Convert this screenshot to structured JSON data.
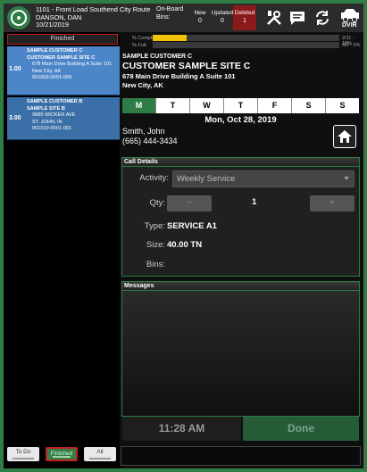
{
  "header": {
    "route_line": "1101 - Front Load Southend City Route",
    "driver": "DANSON, DAN",
    "date": "10/21/2019",
    "onboard_label_1": "On-Board",
    "onboard_label_2": "Bins:",
    "counters": [
      {
        "label": "New",
        "value": "0"
      },
      {
        "label": "Updated",
        "value": "0"
      },
      {
        "label": "Deleted",
        "value": "1"
      }
    ],
    "dvir_label": "DVIR"
  },
  "left": {
    "list_header": "Finished",
    "stops": [
      {
        "qty": "1.00",
        "customer": "SAMPLE CUSTOMER C",
        "site": "CUSTOMER SAMPLE SITE C",
        "address": "678 Main Drive Building A Suite 101",
        "city": "New City, AK",
        "account": "001003-0001-009"
      },
      {
        "qty": "3.00",
        "customer": "SAMPLE CUSTOMER B",
        "site": "SAMPLE SITE B",
        "address": "9885 WICKER AVE",
        "city": "ST. JOHN, IN",
        "account": "001010-0001-001"
      }
    ],
    "tabs": [
      "To Do",
      "Finished",
      "All"
    ]
  },
  "right": {
    "progress": [
      {
        "label": "% Complete:",
        "value": "2/11 - 18%",
        "fraction": 0.18
      },
      {
        "label": "% Full:",
        "value": "0/0 - 0%",
        "fraction": 0
      }
    ],
    "customer": "SAMPLE CUSTOMER C",
    "site": "CUSTOMER SAMPLE SITE C",
    "address1": "678 Main Drive Building A Suite 101",
    "address2": "New City, AK",
    "days": [
      "M",
      "T",
      "W",
      "T",
      "F",
      "S",
      "S"
    ],
    "selected_date": "Mon, Oct 28, 2019",
    "contact_name": "Smith, John",
    "contact_phone": "(665) 444-3434",
    "call_details": {
      "title": "Call Details",
      "activity_label": "Activity:",
      "activity_value": "Weekly Service",
      "qty_label": "Qty:",
      "qty_minus": "−",
      "qty_value": "1",
      "qty_plus": "+",
      "type_label": "Type:",
      "type_value": "SERVICE A1",
      "size_label": "Size:",
      "size_value": "40.00 TN",
      "bins_label": "Bins:",
      "bins_value": ""
    },
    "messages_title": "Messages",
    "time": "11:28 AM",
    "done_label": "Done"
  },
  "colors": {
    "accent": "#2e7d46",
    "selected_stop": "#4c86c8",
    "stop": "#3b6fa8",
    "deleted": "#8b1a1a",
    "progress": "#f0c400"
  }
}
